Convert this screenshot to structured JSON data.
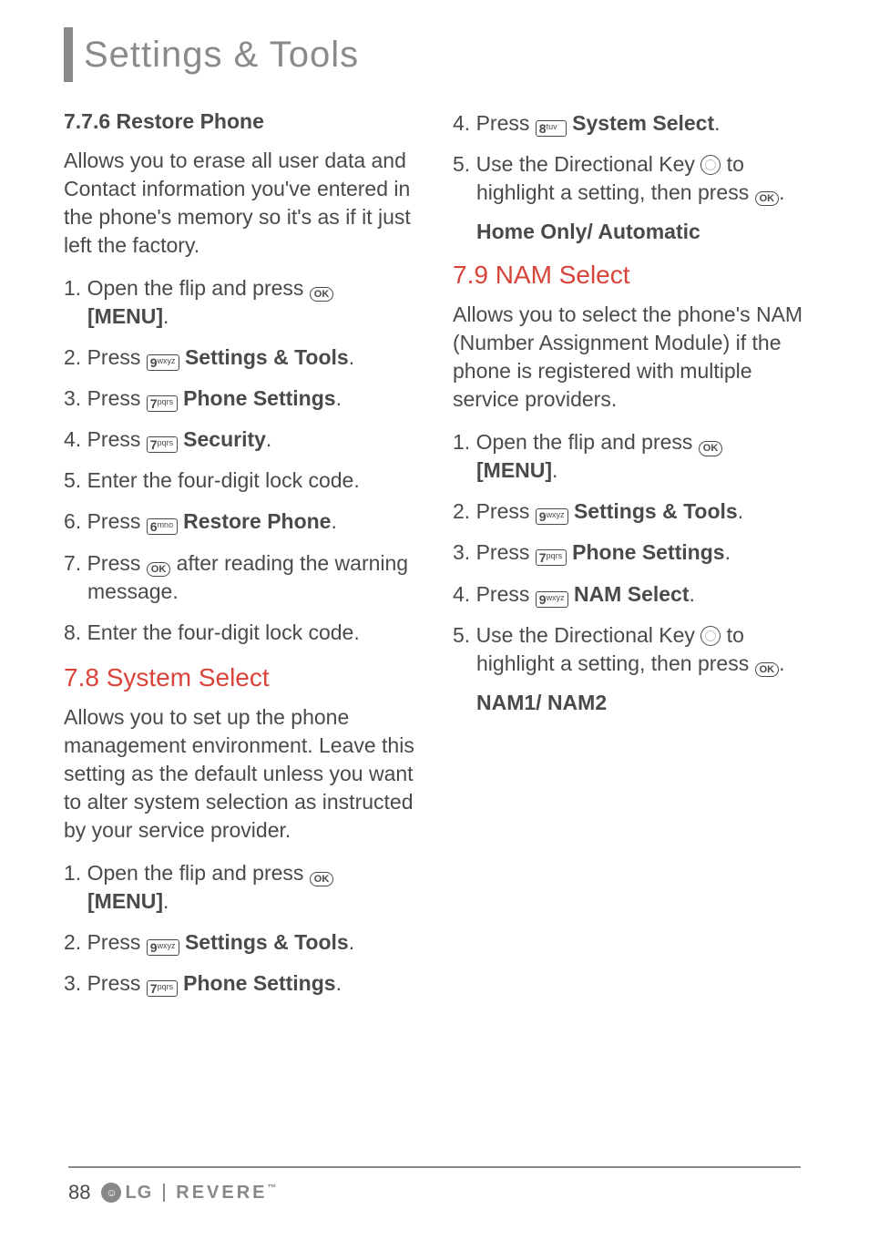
{
  "header": {
    "title": "Settings & Tools"
  },
  "left": {
    "h776": "7.7.6 Restore Phone",
    "p776": "Allows you to erase all user data and Contact information you've entered in the phone's memory so it's as if it just left the factory.",
    "s776": {
      "s1a": "1. Open the flip and press ",
      "s1b": "[MENU]",
      "s2a": "2. Press ",
      "s2b": "Settings & Tools",
      "s3a": "3. Press ",
      "s3b": "Phone Settings",
      "s4a": "4. Press ",
      "s4b": "Security",
      "s5": "5. Enter the four-digit lock code.",
      "s6a": "6. Press ",
      "s6b": "Restore Phone",
      "s7a": "7. Press ",
      "s7b": " after reading the warning message.",
      "s8": "8. Enter the four-digit lock code."
    },
    "h78": "7.8 System Select",
    "p78": "Allows you to set up the phone management environment. Leave this setting as the default unless you want to alter system selection as instructed by your service provider.",
    "s78": {
      "s1a": "1. Open the flip and press ",
      "s1b": "[MENU]",
      "s2a": "2. Press ",
      "s2b": "Settings & Tools",
      "s3a": "3. Press ",
      "s3b": "Phone Settings"
    }
  },
  "right": {
    "s78": {
      "s4a": "4. Press ",
      "s4b": "System Select",
      "s5a": "5. Use the Directional Key ",
      "s5b": " to highlight a setting, then press ",
      "opt": "Home Only/ Automatic"
    },
    "h79": "7.9 NAM Select",
    "p79": "Allows you to select the phone's NAM (Number Assignment Module) if the phone is registered with multiple service providers.",
    "s79": {
      "s1a": "1. Open the flip and press ",
      "s1b": "[MENU]",
      "s2a": "2. Press ",
      "s2b": "Settings & Tools",
      "s3a": "3. Press ",
      "s3b": "Phone Settings",
      "s4a": "4. Press ",
      "s4b": "NAM Select",
      "s5a": "5. Use the Directional Key ",
      "s5b": " to highlight a setting, then press ",
      "opt": "NAM1/ NAM2"
    }
  },
  "keys": {
    "k6": "6",
    "k6s": "mno",
    "k7": "7",
    "k7s": "pqrs",
    "k8": "8",
    "k8s": "tuv",
    "k9": "9",
    "k9s": "wxyz",
    "ok": "OK"
  },
  "footer": {
    "page": "88",
    "lg": "LG",
    "model": "REVERE",
    "tm": "™"
  }
}
